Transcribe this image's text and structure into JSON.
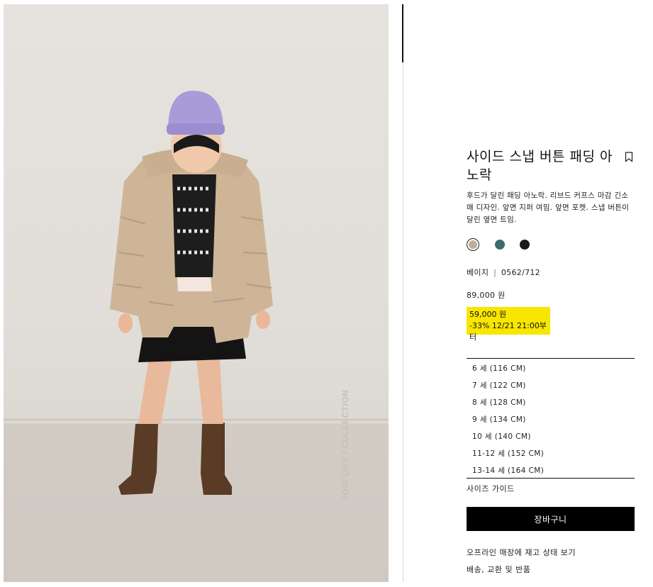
{
  "product": {
    "image_watermark": "JOIN LIFE / COLLECTION",
    "title": "사이드 스냅 버튼 패딩 아노락",
    "description": "후드가 달린 패딩 아노락. 리브드 커프스 마감 긴소매 디자인. 앞면 지퍼 여밈. 앞면 포켓. 스냅 버튼이 달린 옆면 트임.",
    "colors": [
      {
        "name": "beige",
        "hex": "#bfae96",
        "selected": true
      },
      {
        "name": "teal",
        "hex": "#3e6b6b",
        "selected": false
      },
      {
        "name": "black",
        "hex": "#1a1a1a",
        "selected": false
      }
    ],
    "color_label": "베이지",
    "separator": "|",
    "ref_code": "0562/712",
    "original_price": "89,000 원",
    "sale": {
      "price": "59,000 원",
      "note": "-33% 12/21 21:00부터",
      "highlight_color": "#f7e600"
    },
    "sizes": [
      "6 세 (116 CM)",
      "7 세 (122 CM)",
      "8 세 (128 CM)",
      "9 세 (134 CM)",
      "10 세 (140 CM)",
      "11-12 세 (152 CM)",
      "13-14 세 (164 CM)"
    ],
    "size_guide_label": "사이즈 가이드",
    "add_to_cart_label": "장바구니",
    "store_stock_label": "오프라인 매장에 재고 상태 보기",
    "shipping_label": "배송, 교환 및 반품"
  }
}
